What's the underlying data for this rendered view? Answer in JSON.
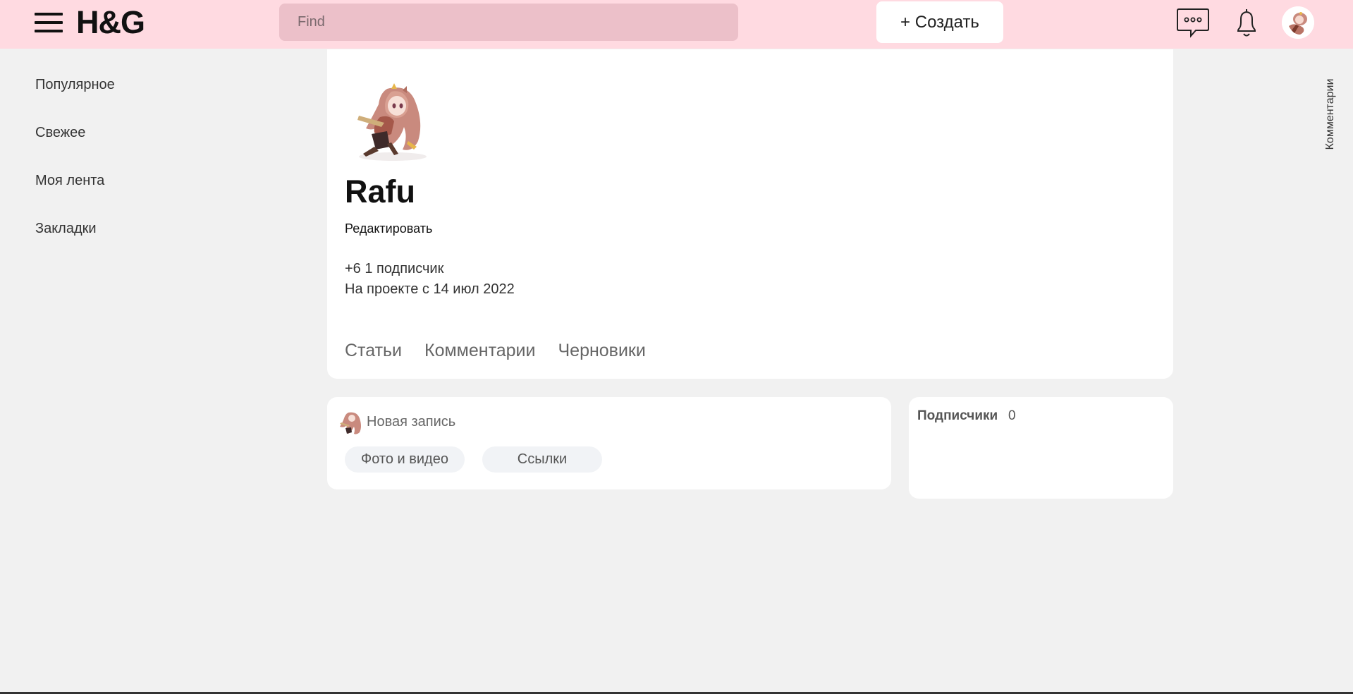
{
  "header": {
    "logo": "H&G",
    "search_placeholder": "Find",
    "create_label": "+ Создать",
    "icons": [
      "menu-icon",
      "chat-icon",
      "bell-icon",
      "avatar"
    ]
  },
  "sidebar": {
    "items": [
      {
        "label": "Популярное"
      },
      {
        "label": "Свежее"
      },
      {
        "label": "Моя лента"
      },
      {
        "label": "Закладки"
      }
    ]
  },
  "right_rail": {
    "comments_label": "Комментарии"
  },
  "profile": {
    "name": "Rafu",
    "edit_label": "Редактировать",
    "rating_subscribers": "+6 1 подписчик",
    "joined": "На проекте с 14 июл 2022",
    "tabs": [
      {
        "label": "Статьи"
      },
      {
        "label": "Комментарии"
      },
      {
        "label": "Черновики"
      }
    ]
  },
  "new_post": {
    "prompt": "Новая запись",
    "chips": [
      {
        "label": "Фото и видео"
      },
      {
        "label": "Ссылки"
      }
    ]
  },
  "subscribers": {
    "title": "Подписчики",
    "count": "0"
  },
  "colors": {
    "header_bg": "#ffdae1",
    "search_bg": "#ecc0c9",
    "page_bg": "#f1f1f1"
  }
}
